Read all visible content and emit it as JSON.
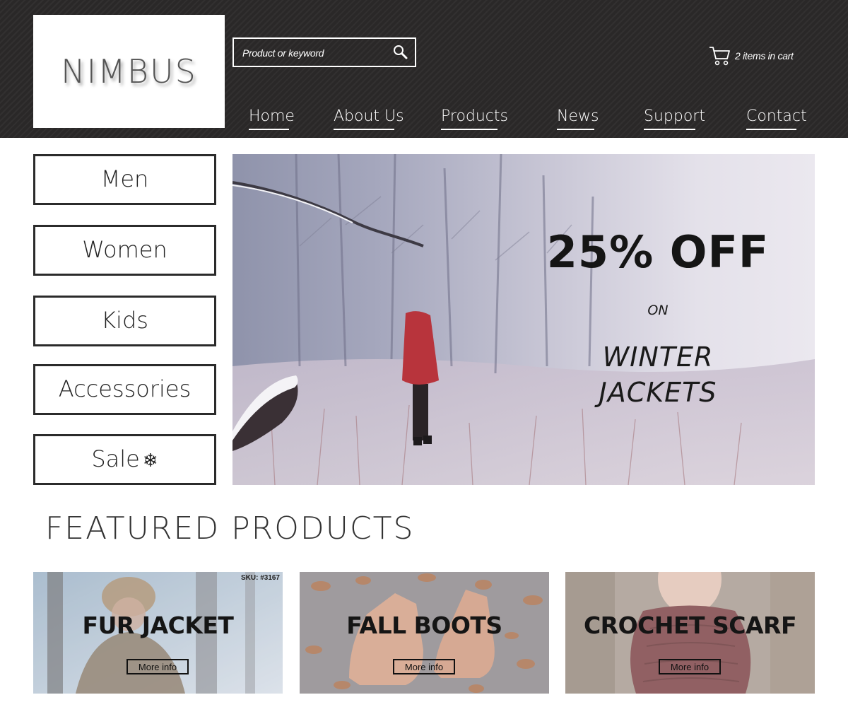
{
  "header": {
    "logo_text": "NIMBUS",
    "search": {
      "placeholder": "Product or keyword"
    },
    "cart_text": "2 items in cart",
    "nav": [
      {
        "label": "Home"
      },
      {
        "label": "About Us"
      },
      {
        "label": "Products"
      },
      {
        "label": "News"
      },
      {
        "label": "Support"
      },
      {
        "label": "Contact"
      }
    ]
  },
  "categories": [
    {
      "label": "Men"
    },
    {
      "label": "Women"
    },
    {
      "label": "Kids"
    },
    {
      "label": "Accessories"
    },
    {
      "label": "Sale",
      "icon": "snowflake-icon"
    }
  ],
  "hero": {
    "headline": "25% OFF",
    "connector": "ON",
    "subline_1": "WINTER",
    "subline_2": "JACKETS"
  },
  "featured": {
    "title": "FEATURED PRODUCTS",
    "products": [
      {
        "title": "FUR JACKET",
        "button": "More info",
        "sku": "SKU: #3167"
      },
      {
        "title": "FALL BOOTS",
        "button": "More info"
      },
      {
        "title": "CROCHET SCARF",
        "button": "More info"
      }
    ]
  },
  "colors": {
    "header_bg": "#2a2828",
    "text_dark": "#151515",
    "border": "#2b2b2b"
  }
}
